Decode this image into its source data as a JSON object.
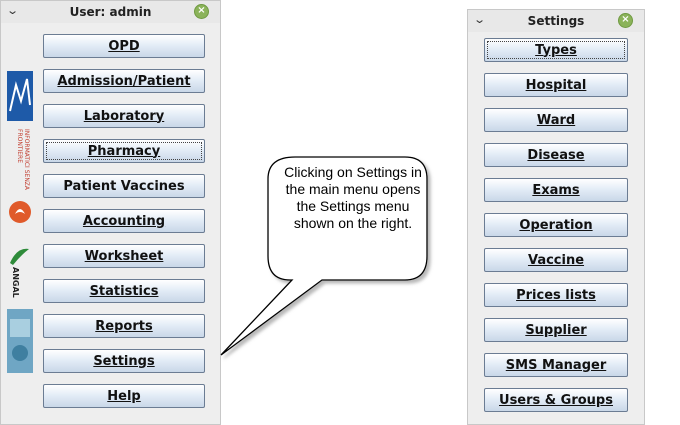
{
  "main_menu": {
    "title": "User: admin",
    "buttons": [
      {
        "label": "OPD"
      },
      {
        "label": "Admission/Patient"
      },
      {
        "label": "Laboratory"
      },
      {
        "label": "Pharmacy"
      },
      {
        "label": "Patient Vaccines"
      },
      {
        "label": "Accounting"
      },
      {
        "label": "Worksheet"
      },
      {
        "label": "Statistics"
      },
      {
        "label": "Reports"
      },
      {
        "label": "Settings"
      },
      {
        "label": "Help"
      }
    ]
  },
  "settings_menu": {
    "title": "Settings",
    "buttons": [
      {
        "label": "Types"
      },
      {
        "label": "Hospital"
      },
      {
        "label": "Ward"
      },
      {
        "label": "Disease"
      },
      {
        "label": "Exams"
      },
      {
        "label": "Operation"
      },
      {
        "label": "Vaccine"
      },
      {
        "label": "Prices lists"
      },
      {
        "label": "Supplier"
      },
      {
        "label": "SMS Manager"
      },
      {
        "label": "Users & Groups"
      }
    ]
  },
  "callout": {
    "text": "Clicking  on Settings in the main menu opens the Settings menu shown on the right."
  },
  "logo_strip": {
    "text": "INFORMATICI SENZA FRONTIERE",
    "text2": "ANGAL"
  },
  "icons": {
    "collapse": "chevron-down-icon",
    "close": "close-icon"
  },
  "colors": {
    "close_button": "#8bb35a",
    "button_border": "#6b7c93"
  }
}
